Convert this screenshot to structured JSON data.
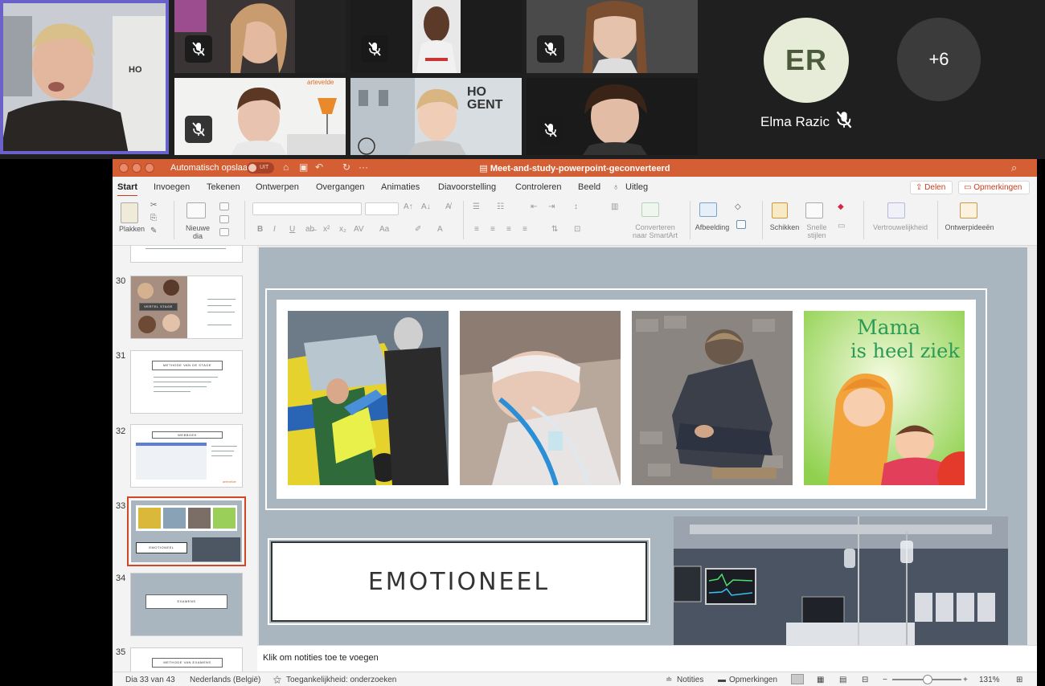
{
  "meeting": {
    "participant_name": "Elma Razic",
    "participant_initials": "ER",
    "overflow_count": "+6"
  },
  "ppt": {
    "autosave_label": "Automatisch opslaan",
    "autosave_state": "UIT",
    "doc_title": "Meet-and-study-powerpoint-geconverteerd",
    "tabs": [
      "Start",
      "Invoegen",
      "Tekenen",
      "Ontwerpen",
      "Overgangen",
      "Animaties",
      "Diavoorstelling",
      "Controleren",
      "Beeld"
    ],
    "tell_me": "Uitleg",
    "share_label": "Delen",
    "comments_label": "Opmerkingen",
    "ribbon": {
      "paste": "Plakken",
      "new_slide_1": "Nieuwe",
      "new_slide_2": "dia",
      "convert_1": "Converteren",
      "convert_2": "naar SmartArt",
      "picture": "Afbeelding",
      "arrange": "Schikken",
      "quick_styles_1": "Snelle",
      "quick_styles_2": "stijlen",
      "sensitivity": "Vertrouwelijkheid",
      "design_ideas": "Ontwerpideeën"
    },
    "thumbnails": [
      {
        "num": "30",
        "title": "VERTEL STAGE"
      },
      {
        "num": "31",
        "title": "METHODE VAN DE STAGE"
      },
      {
        "num": "32",
        "title": "WEBBOEK"
      },
      {
        "num": "33",
        "title": "EMOTIONEEL"
      },
      {
        "num": "34",
        "title": "EXAMENS"
      },
      {
        "num": "35",
        "title": "METHODE VAN EXAMENS"
      }
    ],
    "slide": {
      "title": "EMOTIONEEL",
      "book_title_1": "Mama",
      "book_title_2": "is heel ziek"
    },
    "notes_placeholder": "Klik om notities toe te voegen",
    "status": {
      "slide_info": "Dia 33 van 43",
      "language": "Nederlands (België)",
      "accessibility": "Toegankelijkheid: onderzoeken",
      "notes": "Notities",
      "comments": "Opmerkingen",
      "zoom": "131%"
    }
  },
  "colors": {
    "titlebar": "#d45f35",
    "accent": "#c43e1c",
    "slide_bg": "#aab6bf",
    "speaker_border": "#6b62c9",
    "avatar_bg": "#e7ecd9"
  }
}
